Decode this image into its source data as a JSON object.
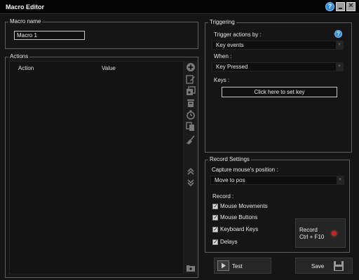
{
  "window": {
    "title": "Macro Editor"
  },
  "macro_name": {
    "legend": "Macro name",
    "value": "Macro 1"
  },
  "actions": {
    "legend": "Actions",
    "columns": [
      "Action",
      "Value"
    ],
    "toolbar": [
      {
        "name": "add-action-icon",
        "glyph": "⊕"
      },
      {
        "name": "edit-action-icon",
        "glyph": "✎"
      },
      {
        "name": "insert-action-icon",
        "glyph": "⧉"
      },
      {
        "name": "delete-action-icon",
        "glyph": "🗑"
      },
      {
        "name": "delay-timer-icon",
        "glyph": "⏱"
      },
      {
        "name": "copy-action-icon",
        "glyph": "⎘"
      },
      {
        "name": "clear-broom-icon",
        "glyph": "🧹"
      },
      {
        "name": "move-up-icon",
        "glyph": "︽"
      },
      {
        "name": "move-down-icon",
        "glyph": "︾"
      },
      {
        "name": "folder-add-icon",
        "glyph": "🗀"
      }
    ]
  },
  "triggering": {
    "legend": "Triggering",
    "trigger_label": "Trigger actions by :",
    "trigger_value": "Key events",
    "when_label": "When :",
    "when_value": "Key Pressed",
    "keys_label": "Keys :",
    "set_key_button": "Click here to set key",
    "help_glyph": "?"
  },
  "record_settings": {
    "legend": "Record Settings",
    "capture_label": "Capture mouse's position :",
    "capture_value": "Move to pos",
    "record_label": "Record :",
    "options": [
      {
        "label": "Mouse Movements",
        "checked": true
      },
      {
        "label": "Mouse Buttons",
        "checked": true
      },
      {
        "label": "Keyboard Keys",
        "checked": true
      },
      {
        "label": "Delays",
        "checked": true
      }
    ],
    "record_button_line1": "Record",
    "record_button_line2": "Ctrl + F10"
  },
  "buttons": {
    "test": "Test",
    "save": "Save"
  },
  "colors": {
    "accent_blue": "#2e8de0",
    "record_red": "#e21818",
    "background": "#151515"
  }
}
